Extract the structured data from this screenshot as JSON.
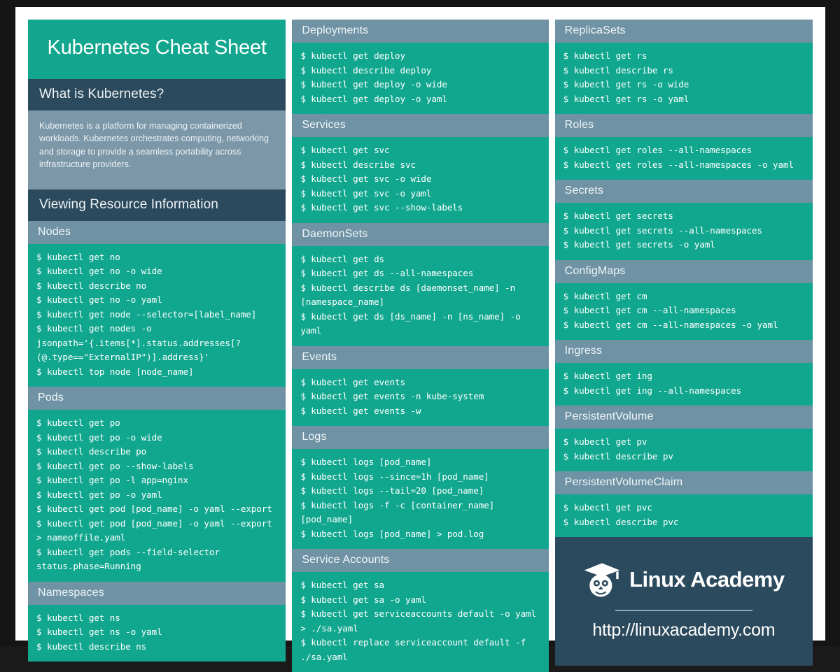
{
  "title": "Kubernetes Cheat Sheet",
  "intro": {
    "heading": "What is Kubernetes?",
    "body": "Kubernetes is a platform for managing containerized workloads. Kubernetes orchestrates computing, networking and storage to provide a seamless portability across infrastructure providers."
  },
  "viewing_heading": "Viewing Resource Information",
  "columns": {
    "left": [
      {
        "heading": "Nodes",
        "commands": [
          "$ kubectl get no",
          "$ kubectl get no -o wide",
          "$ kubectl describe no",
          "$ kubectl get no -o yaml",
          "$ kubectl get node --selector=[label_name]",
          "$ kubectl get nodes -o jsonpath='{.items[*].status.addresses[?(@.type==\"ExternalIP\")].address}'",
          "$ kubectl top node [node_name]"
        ]
      },
      {
        "heading": "Pods",
        "commands": [
          "$ kubectl get po",
          "$ kubectl get po -o wide",
          "$ kubectl describe po",
          "$ kubectl get po --show-labels",
          "$ kubectl get po -l app=nginx",
          "$ kubectl get po -o yaml",
          "$ kubectl get pod [pod_name] -o yaml --export",
          "$ kubectl get pod [pod_name] -o yaml --export > nameoffile.yaml",
          "$ kubectl get pods --field-selector status.phase=Running"
        ]
      },
      {
        "heading": "Namespaces",
        "commands": [
          "$ kubectl get ns",
          "$ kubectl get ns -o yaml",
          "$ kubectl describe ns"
        ]
      }
    ],
    "middle": [
      {
        "heading": "Deployments",
        "commands": [
          "$ kubectl get deploy",
          "$ kubectl describe deploy",
          "$ kubectl get deploy -o wide",
          "$ kubectl get deploy -o yaml"
        ]
      },
      {
        "heading": "Services",
        "commands": [
          "$ kubectl get svc",
          "$ kubectl describe svc",
          "$ kubectl get svc -o wide",
          "$ kubectl get svc -o yaml",
          "$ kubectl get svc --show-labels"
        ]
      },
      {
        "heading": "DaemonSets",
        "commands": [
          "$ kubectl get ds",
          "$ kubectl get ds --all-namespaces",
          "$ kubectl describe ds [daemonset_name] -n [namespace_name]",
          "$ kubectl get ds [ds_name] -n [ns_name] -o yaml"
        ]
      },
      {
        "heading": "Events",
        "commands": [
          "$ kubectl get events",
          "$ kubectl get events -n kube-system",
          "$ kubectl get events -w"
        ]
      },
      {
        "heading": "Logs",
        "commands": [
          "$ kubectl logs [pod_name]",
          "$ kubectl logs --since=1h [pod_name]",
          "$ kubectl logs --tail=20 [pod_name]",
          "$ kubectl logs -f -c [container_name] [pod_name]",
          "$ kubectl logs [pod_name] > pod.log"
        ]
      },
      {
        "heading": "Service Accounts",
        "commands": [
          "$ kubectl get sa",
          "$ kubectl get sa -o yaml",
          "$ kubectl get serviceaccounts default -o yaml > ./sa.yaml",
          "$ kubectl replace serviceaccount default -f ./sa.yaml"
        ]
      }
    ],
    "right": [
      {
        "heading": "ReplicaSets",
        "commands": [
          "$ kubectl get rs",
          "$ kubectl describe rs",
          "$ kubectl get rs -o wide",
          "$ kubectl get rs -o yaml"
        ]
      },
      {
        "heading": "Roles",
        "commands": [
          "$ kubectl get roles --all-namespaces",
          "$ kubectl get roles --all-namespaces -o yaml"
        ]
      },
      {
        "heading": "Secrets",
        "commands": [
          "$ kubectl get secrets",
          "$ kubectl get secrets --all-namespaces",
          "$ kubectl get secrets -o yaml"
        ]
      },
      {
        "heading": "ConfigMaps",
        "commands": [
          "$ kubectl get cm",
          "$ kubectl get cm --all-namespaces",
          "$ kubectl get cm --all-namespaces -o yaml"
        ]
      },
      {
        "heading": "Ingress",
        "commands": [
          "$ kubectl get ing",
          "$ kubectl get ing --all-namespaces"
        ]
      },
      {
        "heading": "PersistentVolume",
        "commands": [
          "$ kubectl get pv",
          "$ kubectl describe pv"
        ]
      },
      {
        "heading": "PersistentVolumeClaim",
        "commands": [
          "$ kubectl get pvc",
          "$ kubectl describe pvc"
        ]
      }
    ]
  },
  "footer": {
    "brand": "Linux Academy",
    "url": "http://linuxacademy.com",
    "logo_icon": "owl-graduation-cap-icon"
  },
  "colors": {
    "teal": "#11a78f",
    "navy": "#2c4a5d",
    "gray_blue": "#6f93a4",
    "intro_bg": "#7b97a8",
    "page_bg": "#ffffff",
    "frame": "#151515"
  }
}
